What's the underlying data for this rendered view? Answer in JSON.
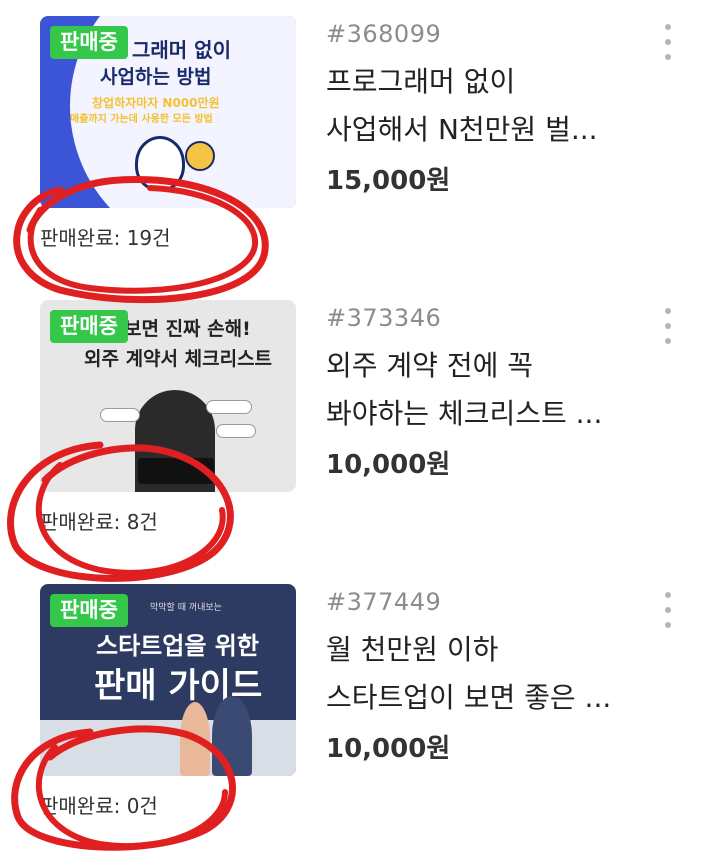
{
  "products": [
    {
      "badge": "판매중",
      "sold": "판매완료: 19건",
      "id": "#368099",
      "title_line1": "프로그래머 없이",
      "title_line2": "사업해서 N천만원 벌...",
      "price": "15,000원",
      "thumb_text": [
        "그래머 없이",
        "사업하는 방법",
        "창업하자마자 N000만원",
        "매출까지 가는데 사용한 모든 방법"
      ]
    },
    {
      "badge": "판매중",
      "sold": "판매완료: 8건",
      "id": "#373346",
      "title_line1": "외주 계약 전에 꼭",
      "title_line2": "봐야하는 체크리스트 ...",
      "price": "10,000원",
      "thumb_text": [
        "보면 진짜 손해!",
        "외주 계약서 체크리스트"
      ]
    },
    {
      "badge": "판매중",
      "sold": "판매완료: 0건",
      "id": "#377449",
      "title_line1": "월 천만원 이하",
      "title_line2": "스타트업이 보면 좋은 ...",
      "price": "10,000원",
      "thumb_text": [
        "막막할 때 꺼내보는",
        "스타트업을 위한",
        "판매 가이드"
      ]
    }
  ],
  "colors": {
    "badge_green": "#35c74a",
    "annotation_red": "#e02020"
  },
  "icons": [
    "more-vertical-icon"
  ]
}
